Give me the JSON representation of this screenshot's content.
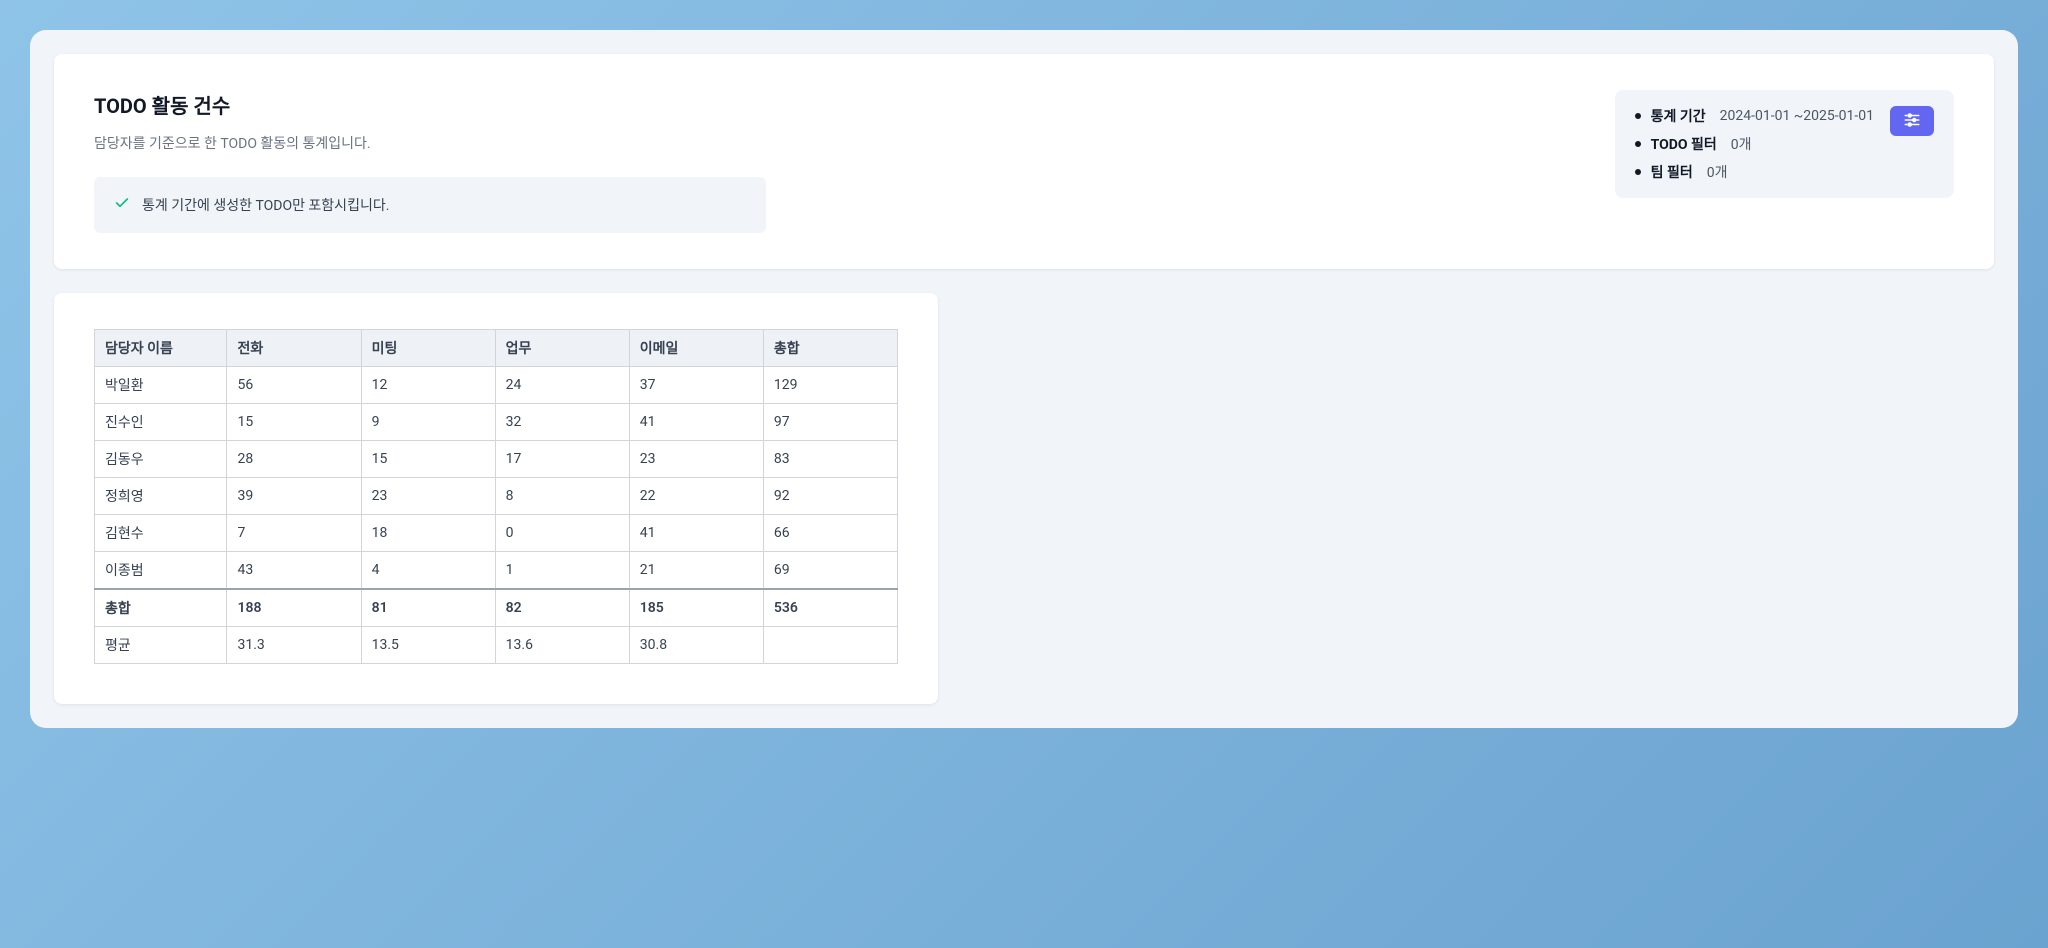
{
  "header": {
    "title": "TODO 활동 건수",
    "subtitle": "담당자를 기준으로 한 TODO 활동의 통계입니다.",
    "info_text": "통계 기간에 생성한 TODO만 포함시킵니다."
  },
  "filters": {
    "period_label": "통계 기간",
    "period_value": "2024-01-01 ~2025-01-01",
    "todo_label": "TODO 필터",
    "todo_value": "0개",
    "team_label": "팀 필터",
    "team_value": "0개"
  },
  "table": {
    "headers": [
      "담당자 이름",
      "전화",
      "미팅",
      "업무",
      "이메일",
      "총합"
    ],
    "rows": [
      [
        "박일환",
        "56",
        "12",
        "24",
        "37",
        "129"
      ],
      [
        "진수인",
        "15",
        "9",
        "32",
        "41",
        "97"
      ],
      [
        "김동우",
        "28",
        "15",
        "17",
        "23",
        "83"
      ],
      [
        "정희영",
        "39",
        "23",
        "8",
        "22",
        "92"
      ],
      [
        "김현수",
        "7",
        "18",
        "0",
        "41",
        "66"
      ],
      [
        "이종범",
        "43",
        "4",
        "1",
        "21",
        "69"
      ]
    ],
    "totals": [
      "총합",
      "188",
      "81",
      "82",
      "185",
      "536"
    ],
    "averages": [
      "평균",
      "31.3",
      "13.5",
      "13.6",
      "30.8",
      ""
    ]
  },
  "chart_data": {
    "type": "table",
    "title": "TODO 활동 건수",
    "columns": [
      "담당자 이름",
      "전화",
      "미팅",
      "업무",
      "이메일",
      "총합"
    ],
    "rows": [
      {
        "name": "박일환",
        "전화": 56,
        "미팅": 12,
        "업무": 24,
        "이메일": 37,
        "총합": 129
      },
      {
        "name": "진수인",
        "전화": 15,
        "미팅": 9,
        "업무": 32,
        "이메일": 41,
        "총합": 97
      },
      {
        "name": "김동우",
        "전화": 28,
        "미팅": 15,
        "업무": 17,
        "이메일": 23,
        "총합": 83
      },
      {
        "name": "정희영",
        "전화": 39,
        "미팅": 23,
        "업무": 8,
        "이메일": 22,
        "총합": 92
      },
      {
        "name": "김현수",
        "전화": 7,
        "미팅": 18,
        "업무": 0,
        "이메일": 41,
        "총합": 66
      },
      {
        "name": "이종범",
        "전화": 43,
        "미팅": 4,
        "업무": 1,
        "이메일": 21,
        "총합": 69
      }
    ],
    "totals": {
      "전화": 188,
      "미팅": 81,
      "업무": 82,
      "이메일": 185,
      "총합": 536
    },
    "averages": {
      "전화": 31.3,
      "미팅": 13.5,
      "업무": 13.6,
      "이메일": 30.8
    }
  }
}
